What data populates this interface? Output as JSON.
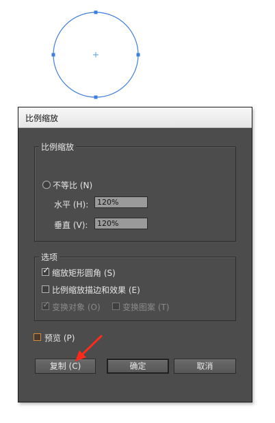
{
  "colors": {
    "selection": "#3b7ddd",
    "arrow": "#ff2a1a",
    "dialog_bg": "#4c4c4c"
  },
  "dialog": {
    "title": "比例缩放",
    "scale_group": {
      "legend": "比例缩放",
      "non_uniform": {
        "label": "不等比 (N)",
        "selected": true
      },
      "horizontal": {
        "label": "水平 (H):",
        "value": "120%"
      },
      "vertical": {
        "label": "垂直 (V):",
        "value": "120%"
      }
    },
    "options_group": {
      "legend": "选项",
      "scale_corners": {
        "label": "缩放矩形圆角 (S)",
        "checked": true
      },
      "scale_strokes": {
        "label": "比例缩放描边和效果 (E)",
        "checked": false
      },
      "transform_objects": {
        "label": "变换对象 (O)",
        "checked": true,
        "disabled": true
      },
      "transform_patterns": {
        "label": "变换图案 (T)",
        "checked": false,
        "disabled": true
      }
    },
    "preview": {
      "label": "预览 (P)",
      "checked": false
    },
    "buttons": {
      "copy": "复制 (C)",
      "ok": "确定",
      "cancel": "取消"
    }
  }
}
